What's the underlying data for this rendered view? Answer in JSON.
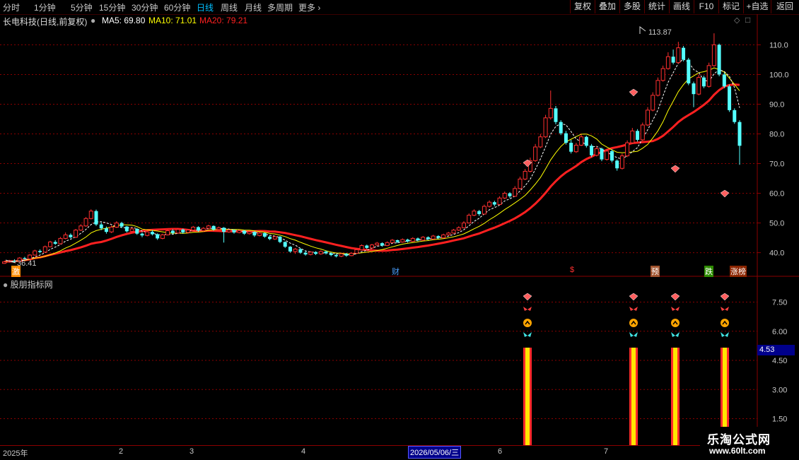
{
  "toolbar": {
    "timeframes": [
      "分时",
      "1分钟",
      "5分钟",
      "15分钟",
      "30分钟",
      "60分钟",
      "日线",
      "周线",
      "月线",
      "多周期",
      "更多"
    ],
    "active": "日线",
    "buttons": [
      "复权",
      "叠加",
      "多股",
      "统计",
      "画线",
      "F10",
      "标记",
      "+自选",
      "返回"
    ]
  },
  "info": {
    "stock": "长电科技(日线,前复权)",
    "ma5": "MA5: 69.80",
    "ma10": "MA10: 71.01",
    "ma20": "MA20: 79.21",
    "ma5_color": "#ffffff",
    "ma10_color": "#ffff00",
    "ma20_color": "#ff2020"
  },
  "price_axis": [
    "110.0",
    "100.0",
    "90.0",
    "80.0",
    "70.0",
    "60.0",
    "50.0",
    "40.0"
  ],
  "annotations": {
    "high": "113.87",
    "low": "36.41"
  },
  "event_tags": [
    "激",
    "财",
    "$",
    "预",
    "跌",
    "涨榜"
  ],
  "indicator": {
    "title": "股朋指标网",
    "axis": [
      "7.50",
      "6.00",
      "4.50",
      "3.00",
      "1.50"
    ],
    "current_value": "4.53"
  },
  "date_axis": {
    "labels": [
      "2025年",
      "2",
      "3",
      "4",
      "6",
      "7"
    ],
    "selected": "2026/05/06/三"
  },
  "watermark": {
    "name": "乐淘公式网",
    "url": "www.60lt.com"
  },
  "colors": {
    "up": "#ff3030",
    "down": "#54ffff",
    "grid": "#8b0000",
    "accent": "#00bfff"
  },
  "chart_data": {
    "type": "candlestick",
    "title": "长电科技(日线,前复权)",
    "ylim": [
      33,
      117
    ],
    "x_count": 150,
    "candles": [
      [
        36.4,
        36.9,
        36.2,
        37.0,
        "up"
      ],
      [
        36.9,
        37.3,
        36.6,
        37.6,
        "up"
      ],
      [
        37.3,
        37.0,
        36.8,
        37.8,
        "down"
      ],
      [
        37.0,
        38.2,
        36.9,
        38.5,
        "up"
      ],
      [
        38.2,
        37.9,
        37.6,
        38.6,
        "down"
      ],
      [
        37.9,
        39.2,
        37.7,
        39.5,
        "up"
      ],
      [
        39.2,
        40.6,
        39.0,
        41.0,
        "up"
      ],
      [
        40.6,
        40.2,
        39.8,
        41.1,
        "down"
      ],
      [
        40.2,
        42.0,
        40.0,
        42.4,
        "up"
      ],
      [
        42.0,
        43.6,
        41.8,
        44.0,
        "up"
      ],
      [
        43.6,
        43.0,
        42.6,
        44.2,
        "down"
      ],
      [
        43.0,
        44.8,
        42.8,
        45.3,
        "up"
      ],
      [
        44.8,
        46.0,
        44.5,
        46.8,
        "up"
      ],
      [
        46.0,
        45.2,
        44.8,
        46.5,
        "down"
      ],
      [
        45.2,
        47.6,
        45.0,
        48.0,
        "up"
      ],
      [
        47.6,
        49.0,
        47.3,
        49.6,
        "up"
      ],
      [
        49.0,
        51.5,
        48.7,
        52.0,
        "up"
      ],
      [
        51.5,
        54.0,
        51.2,
        54.6,
        "up"
      ],
      [
        54.0,
        49.5,
        49.0,
        54.5,
        "down"
      ],
      [
        49.5,
        48.2,
        47.6,
        50.2,
        "down"
      ],
      [
        48.2,
        47.0,
        46.4,
        48.8,
        "down"
      ],
      [
        47.0,
        48.6,
        46.6,
        49.2,
        "up"
      ],
      [
        48.6,
        50.0,
        48.3,
        50.6,
        "up"
      ],
      [
        50.0,
        48.8,
        48.3,
        50.4,
        "down"
      ],
      [
        48.8,
        47.2,
        46.8,
        49.0,
        "down"
      ],
      [
        47.2,
        48.0,
        46.9,
        48.6,
        "up"
      ],
      [
        48.0,
        46.4,
        46.0,
        48.3,
        "down"
      ],
      [
        46.4,
        45.8,
        45.2,
        46.8,
        "down"
      ],
      [
        45.8,
        47.0,
        45.5,
        47.5,
        "up"
      ],
      [
        47.0,
        46.2,
        45.8,
        47.6,
        "down"
      ],
      [
        46.2,
        44.8,
        44.3,
        46.5,
        "down"
      ],
      [
        44.8,
        46.0,
        44.5,
        46.4,
        "up"
      ],
      [
        46.0,
        47.4,
        45.8,
        47.8,
        "up"
      ],
      [
        47.4,
        46.6,
        46.2,
        47.9,
        "down"
      ],
      [
        46.6,
        47.8,
        46.4,
        48.3,
        "up"
      ],
      [
        47.8,
        46.8,
        46.4,
        48.1,
        "down"
      ],
      [
        46.8,
        47.6,
        46.5,
        48.0,
        "up"
      ],
      [
        47.6,
        48.6,
        47.3,
        49.0,
        "up"
      ],
      [
        48.6,
        47.4,
        47.0,
        48.9,
        "down"
      ],
      [
        47.4,
        48.2,
        47.0,
        48.6,
        "up"
      ],
      [
        48.2,
        49.0,
        47.9,
        49.4,
        "up"
      ],
      [
        49.0,
        47.8,
        47.4,
        49.2,
        "down"
      ],
      [
        47.8,
        48.4,
        47.5,
        48.8,
        "up"
      ],
      [
        48.4,
        47.0,
        43.4,
        48.6,
        "down"
      ],
      [
        47.0,
        47.6,
        46.7,
        48.0,
        "up"
      ],
      [
        47.6,
        46.8,
        46.4,
        47.9,
        "down"
      ],
      [
        46.8,
        47.4,
        46.5,
        47.8,
        "up"
      ],
      [
        47.4,
        46.4,
        46.0,
        47.6,
        "down"
      ],
      [
        46.4,
        47.0,
        46.1,
        47.3,
        "up"
      ],
      [
        47.0,
        45.8,
        45.3,
        47.2,
        "down"
      ],
      [
        45.8,
        46.6,
        45.5,
        47.0,
        "up"
      ],
      [
        46.6,
        45.4,
        45.0,
        46.8,
        "down"
      ],
      [
        45.4,
        44.6,
        44.2,
        45.8,
        "down"
      ],
      [
        44.6,
        45.4,
        44.3,
        45.8,
        "up"
      ],
      [
        45.4,
        43.6,
        43.2,
        45.6,
        "down"
      ],
      [
        43.6,
        42.0,
        41.6,
        43.8,
        "down"
      ],
      [
        42.0,
        40.4,
        40.0,
        42.2,
        "down"
      ],
      [
        40.4,
        41.2,
        39.6,
        41.6,
        "up"
      ],
      [
        41.2,
        40.0,
        39.6,
        41.5,
        "down"
      ],
      [
        40.0,
        39.4,
        39.0,
        40.6,
        "down"
      ],
      [
        39.4,
        40.2,
        39.1,
        40.5,
        "up"
      ],
      [
        40.2,
        39.6,
        39.2,
        40.5,
        "down"
      ],
      [
        39.6,
        40.4,
        39.3,
        40.8,
        "up"
      ],
      [
        40.4,
        39.8,
        39.4,
        40.7,
        "down"
      ],
      [
        39.8,
        39.2,
        38.8,
        40.1,
        "down"
      ],
      [
        39.2,
        38.8,
        38.4,
        39.6,
        "down"
      ],
      [
        38.8,
        39.6,
        38.5,
        40.0,
        "up"
      ],
      [
        39.6,
        39.0,
        38.6,
        39.9,
        "down"
      ],
      [
        39.0,
        39.8,
        38.8,
        40.2,
        "up"
      ],
      [
        39.8,
        41.0,
        39.6,
        41.4,
        "up"
      ],
      [
        41.0,
        42.4,
        40.8,
        42.8,
        "up"
      ],
      [
        42.4,
        41.6,
        41.2,
        42.7,
        "down"
      ],
      [
        41.6,
        42.6,
        41.3,
        43.0,
        "up"
      ],
      [
        42.6,
        43.2,
        42.3,
        43.6,
        "up"
      ],
      [
        43.2,
        42.4,
        42.0,
        43.5,
        "down"
      ],
      [
        42.4,
        43.4,
        42.2,
        43.8,
        "up"
      ],
      [
        43.4,
        44.2,
        43.1,
        44.6,
        "up"
      ],
      [
        44.2,
        43.6,
        43.2,
        44.4,
        "down"
      ],
      [
        43.6,
        44.4,
        43.4,
        44.8,
        "up"
      ],
      [
        44.4,
        43.8,
        43.4,
        44.7,
        "down"
      ],
      [
        43.8,
        44.8,
        43.6,
        45.2,
        "up"
      ],
      [
        44.8,
        44.2,
        43.8,
        45.1,
        "down"
      ],
      [
        44.2,
        45.2,
        44.0,
        45.6,
        "up"
      ],
      [
        45.2,
        44.6,
        44.2,
        45.5,
        "down"
      ],
      [
        44.6,
        45.6,
        44.4,
        46.0,
        "up"
      ],
      [
        45.6,
        45.0,
        44.6,
        45.9,
        "down"
      ],
      [
        45.0,
        46.0,
        44.8,
        46.4,
        "up"
      ],
      [
        46.0,
        46.6,
        45.7,
        47.0,
        "up"
      ],
      [
        46.6,
        47.6,
        46.4,
        48.0,
        "up"
      ],
      [
        47.6,
        48.4,
        47.3,
        48.9,
        "up"
      ],
      [
        48.4,
        50.0,
        48.2,
        50.6,
        "up"
      ],
      [
        50.0,
        52.6,
        49.8,
        53.2,
        "up"
      ],
      [
        52.6,
        54.0,
        52.3,
        54.6,
        "up"
      ],
      [
        54.0,
        53.0,
        52.4,
        54.4,
        "down"
      ],
      [
        53.0,
        55.6,
        52.8,
        56.2,
        "up"
      ],
      [
        55.6,
        57.0,
        55.2,
        57.6,
        "up"
      ],
      [
        57.0,
        56.2,
        55.6,
        57.5,
        "down"
      ],
      [
        56.2,
        58.4,
        56.0,
        59.0,
        "up"
      ],
      [
        58.4,
        60.0,
        58.0,
        60.6,
        "up"
      ],
      [
        60.0,
        59.0,
        58.4,
        60.4,
        "down"
      ],
      [
        59.0,
        61.6,
        58.8,
        62.4,
        "up"
      ],
      [
        61.6,
        64.8,
        61.3,
        65.6,
        "up"
      ],
      [
        64.8,
        67.4,
        64.4,
        68.2,
        "up"
      ],
      [
        67.4,
        71.0,
        67.0,
        72.0,
        "up"
      ],
      [
        71.0,
        75.6,
        70.6,
        76.6,
        "up"
      ],
      [
        75.6,
        79.0,
        75.2,
        80.0,
        "up"
      ],
      [
        79.0,
        85.4,
        78.6,
        86.4,
        "up"
      ],
      [
        85.4,
        88.6,
        84.8,
        94.6,
        "up"
      ],
      [
        88.6,
        84.0,
        83.2,
        89.4,
        "down"
      ],
      [
        84.0,
        80.2,
        79.6,
        84.6,
        "down"
      ],
      [
        80.2,
        77.0,
        76.4,
        81.0,
        "down"
      ],
      [
        77.0,
        74.0,
        73.4,
        78.0,
        "down"
      ],
      [
        74.0,
        76.2,
        73.6,
        77.0,
        "up"
      ],
      [
        76.2,
        79.0,
        75.9,
        79.8,
        "up"
      ],
      [
        79.0,
        76.0,
        75.4,
        79.4,
        "down"
      ],
      [
        76.0,
        72.8,
        72.2,
        76.6,
        "down"
      ],
      [
        72.8,
        75.0,
        72.4,
        75.8,
        "up"
      ],
      [
        75.0,
        71.4,
        70.8,
        75.4,
        "down"
      ],
      [
        71.4,
        74.2,
        71.0,
        75.0,
        "up"
      ],
      [
        74.2,
        71.0,
        70.4,
        74.8,
        "down"
      ],
      [
        71.0,
        68.4,
        67.6,
        71.4,
        "down"
      ],
      [
        68.4,
        72.6,
        68.0,
        73.4,
        "up"
      ],
      [
        72.6,
        77.0,
        72.2,
        77.8,
        "up"
      ],
      [
        77.0,
        81.0,
        76.6,
        82.0,
        "up"
      ],
      [
        81.0,
        78.0,
        77.4,
        81.6,
        "down"
      ],
      [
        78.0,
        83.0,
        77.6,
        83.8,
        "up"
      ],
      [
        83.0,
        88.0,
        82.6,
        89.0,
        "up"
      ],
      [
        88.0,
        93.0,
        87.6,
        94.0,
        "up"
      ],
      [
        93.0,
        98.0,
        92.6,
        99.0,
        "up"
      ],
      [
        98.0,
        102.0,
        97.6,
        103.0,
        "up"
      ],
      [
        102.0,
        106.0,
        101.6,
        107.5,
        "up"
      ],
      [
        106.0,
        104.0,
        103.4,
        108.4,
        "down"
      ],
      [
        104.0,
        109.0,
        103.6,
        111.0,
        "up"
      ],
      [
        109.0,
        105.0,
        104.4,
        109.6,
        "down"
      ],
      [
        105.0,
        97.0,
        96.4,
        105.6,
        "down"
      ],
      [
        97.0,
        93.4,
        89.0,
        97.6,
        "down"
      ],
      [
        93.4,
        99.0,
        93.0,
        100.0,
        "up"
      ],
      [
        99.0,
        96.0,
        95.4,
        99.6,
        "down"
      ],
      [
        96.0,
        103.0,
        95.6,
        104.0,
        "up"
      ],
      [
        103.0,
        110.0,
        102.6,
        113.87,
        "up"
      ],
      [
        110.0,
        100.0,
        99.4,
        110.4,
        "down"
      ],
      [
        100.0,
        96.0,
        95.4,
        100.6,
        "down"
      ],
      [
        96.0,
        88.0,
        87.4,
        96.6,
        "down"
      ],
      [
        88.0,
        84.0,
        83.4,
        88.6,
        "down"
      ],
      [
        84.0,
        76.0,
        69.6,
        84.6,
        "down"
      ]
    ]
  }
}
